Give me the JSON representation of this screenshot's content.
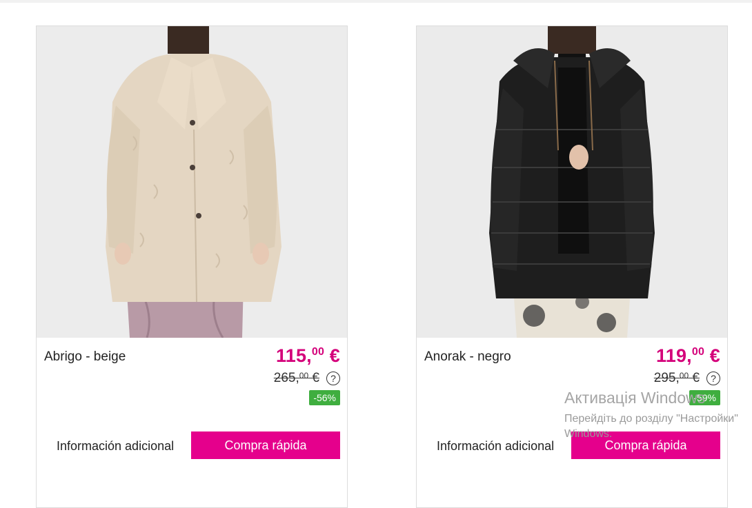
{
  "products": [
    {
      "name": "Abrigo - beige",
      "price_main": "115,",
      "price_cents": "00",
      "price_currency": " €",
      "old_price_main": "265,",
      "old_price_cents": "00",
      "old_price_currency": " €",
      "discount": "-56%",
      "info_label": "Información adicional",
      "buy_label": "Compra rápida",
      "image_icon": "beige-fur-coat-photo"
    },
    {
      "name": "Anorak - negro",
      "price_main": "119,",
      "price_cents": "00",
      "price_currency": " €",
      "old_price_main": "295,",
      "old_price_cents": "00",
      "old_price_currency": " €",
      "discount": "-59%",
      "info_label": "Información adicional",
      "buy_label": "Compra rápida",
      "image_icon": "black-puffer-anorak-photo"
    }
  ],
  "help_glyph": "?",
  "watermark": {
    "line1": "Активація Windows",
    "line2": "Перейдіть до розділу \"Настройки\"",
    "line3": "Windows."
  },
  "colors": {
    "accent": "#e5008c",
    "price": "#d4007a",
    "discount_badge": "#3fae3f"
  }
}
